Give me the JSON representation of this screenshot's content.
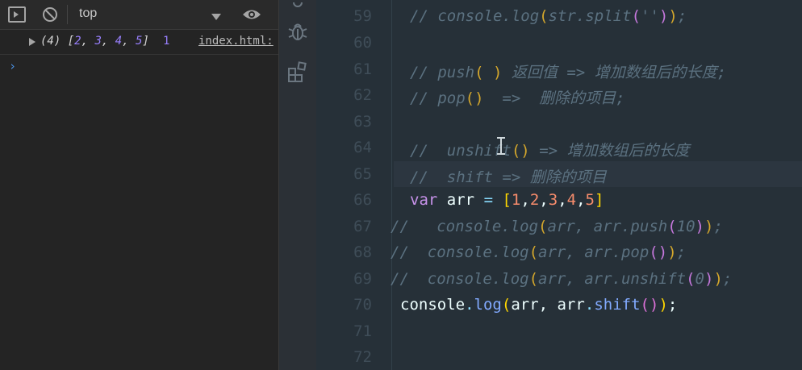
{
  "devtools": {
    "context": "top",
    "log": {
      "prefix": "(4) [",
      "values": [
        "2",
        "3",
        "4",
        "5"
      ],
      "suffix": "]",
      "extra": "1",
      "source": "index.html:"
    },
    "prompt": "›"
  },
  "editor": {
    "lines": [
      {
        "num": "59",
        "text": "// console.log(str.split(''));"
      },
      {
        "num": "60",
        "text": ""
      },
      {
        "num": "61",
        "text": "// push( ) 返回值 => 增加数组后的长度;"
      },
      {
        "num": "62",
        "text": "// pop()  =>  删除的项目;"
      },
      {
        "num": "63",
        "text": ""
      },
      {
        "num": "64",
        "text": "//  unshift() => 增加数组后的长度"
      },
      {
        "num": "65",
        "text": "//  shift => 删除的项目"
      },
      {
        "num": "66",
        "text": "var arr = [1,2,3,4,5]"
      },
      {
        "num": "67",
        "text": "//   console.log(arr, arr.push(10));"
      },
      {
        "num": "68",
        "text": "//  console.log(arr, arr.pop());"
      },
      {
        "num": "69",
        "text": "//  console.log(arr, arr.unshift(0));"
      },
      {
        "num": "70",
        "text": "console.log(arr, arr.shift());"
      },
      {
        "num": "71",
        "text": ""
      },
      {
        "num": "72",
        "text": ""
      }
    ]
  },
  "colors": {
    "console_bg": "#242424",
    "editor_bg": "#263038",
    "number": "#9980ff",
    "keyword": "#c792ea",
    "function": "#82aaff",
    "comment": "#5b7180"
  },
  "icons": {
    "toolbar": [
      "sidebar-toggle-icon",
      "clear-console-icon",
      "chevron-down-icon",
      "eye-icon"
    ],
    "activity": [
      "debug-icon",
      "extensions-icon"
    ]
  }
}
